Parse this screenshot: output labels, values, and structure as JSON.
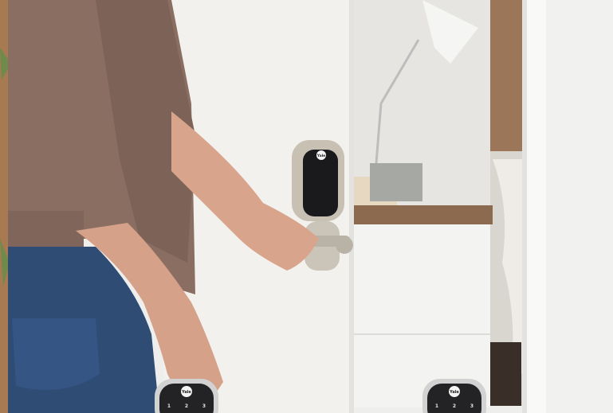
{
  "photo": {
    "brand_mark": "Yale",
    "keypads": [
      {
        "brand": "Yale",
        "keys": [
          "1",
          "2",
          "3"
        ]
      },
      {
        "brand": "Yale",
        "keys": [
          "1",
          "2",
          "3"
        ]
      }
    ],
    "colors": {
      "wall": "#ecebe8",
      "door": "#f2f1ee",
      "door_frame": "#f7f7f6",
      "sweater": "#8a6e62",
      "jeans": "#2f4c74",
      "skin": "#d9a48c",
      "lock_finish": "#c9c0b4",
      "lock_screen": "#1a1a1c",
      "wood_shelf": "#8c6a4f",
      "cabinet": "#f3f3f1"
    }
  }
}
